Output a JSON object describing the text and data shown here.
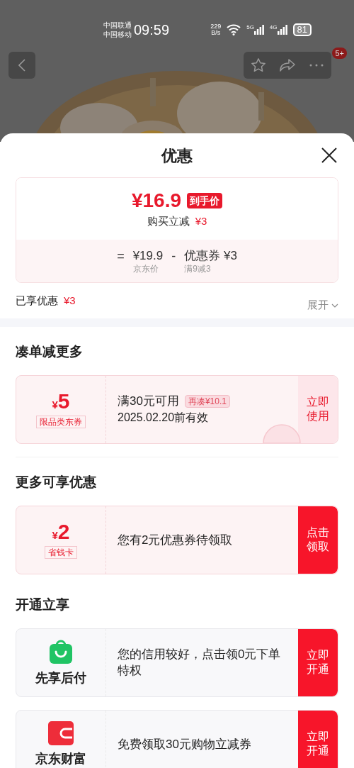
{
  "status_bar": {
    "carriers": [
      "中国联通",
      "中国移动"
    ],
    "time": "09:59",
    "speed": [
      "229",
      "B/s"
    ],
    "networks": [
      "5G",
      "4G"
    ],
    "battery": "81"
  },
  "nav": {
    "badge": "5+"
  },
  "sheet": {
    "title": "优惠",
    "price_card": {
      "price": "¥16.9",
      "price_tag": "到手价",
      "reduce_label": "购买立减",
      "reduce_amount": "¥3",
      "formula": [
        {
          "kind": "op",
          "text": "="
        },
        {
          "kind": "term",
          "value": "¥19.9",
          "note": "京东价"
        },
        {
          "kind": "op",
          "text": "-"
        },
        {
          "kind": "term",
          "value": "优惠券 ¥3",
          "note": "满9减3"
        }
      ]
    },
    "enjoyed": {
      "label": "已享优惠",
      "amount": "¥3",
      "expand": "展开"
    },
    "sections": [
      {
        "title": "凑单减更多",
        "cards": [
          {
            "kind": "coupon",
            "currency": "¥",
            "amount": "5",
            "tag": "限品类东券",
            "lines": [
              "满30元可用",
              "2025.02.20前有效"
            ],
            "badge": "再凑¥10.1",
            "used": true,
            "action": "立即使用",
            "highlighted": false
          }
        ]
      },
      {
        "title": "更多可享优惠",
        "cards": [
          {
            "kind": "coupon",
            "currency": "¥",
            "amount": "2",
            "tag": "省钱卡",
            "lines": [
              "您有2元优惠券待领取"
            ],
            "used": false,
            "action": "点击领取",
            "highlighted": true
          }
        ]
      },
      {
        "title": "开通立享",
        "cards": [
          {
            "kind": "service",
            "name": "先享后付",
            "lines": [
              "您的信用较好，点击领0元下单特权"
            ],
            "action": "立即开通",
            "highlighted": true
          },
          {
            "kind": "service",
            "name": "京东财富",
            "lines": [
              "免费领取30元购物立减券"
            ],
            "action": "立即开通",
            "highlighted": true
          }
        ]
      }
    ]
  }
}
